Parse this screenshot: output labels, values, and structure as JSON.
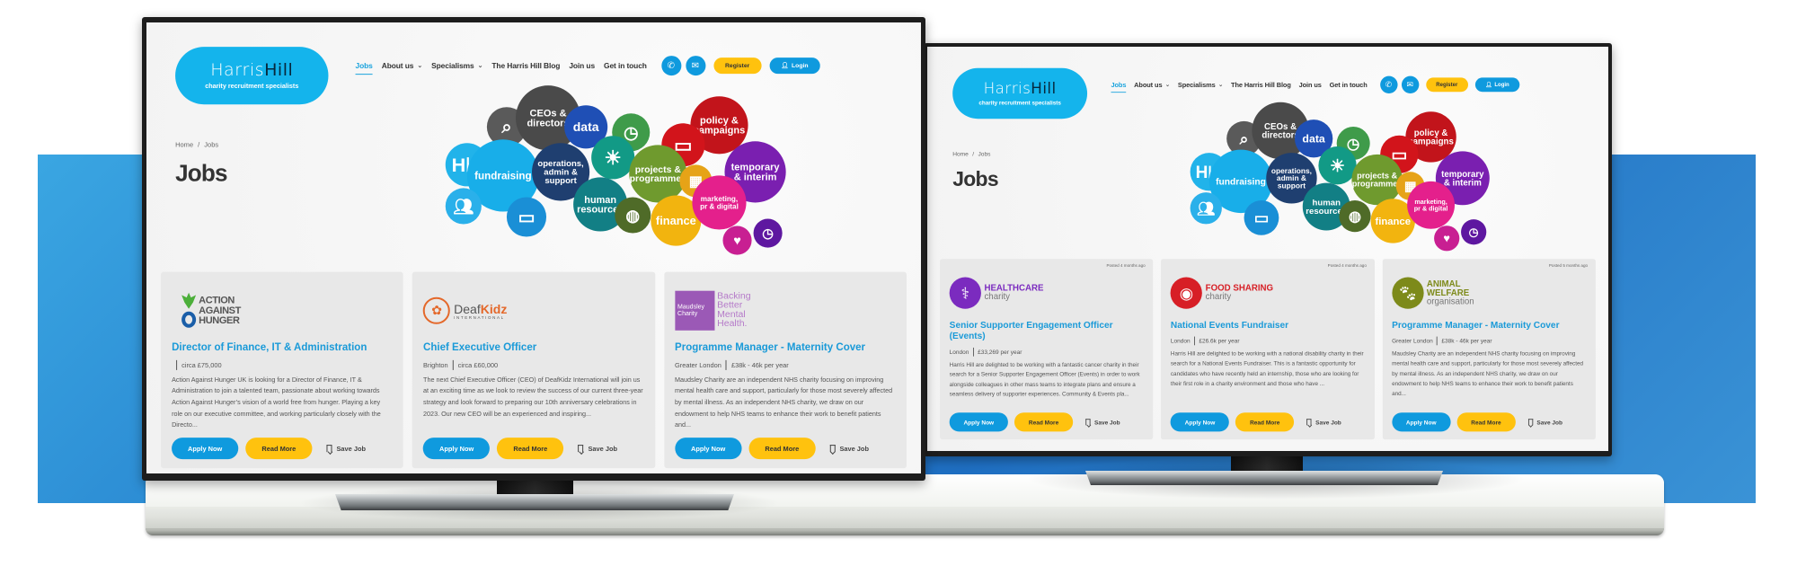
{
  "site": {
    "logo": {
      "word_light": "Harris",
      "word_bold": "Hill",
      "tagline": "charity recruitment specialists"
    },
    "nav": [
      {
        "label": "Jobs",
        "active": true,
        "dropdown": false
      },
      {
        "label": "About us",
        "active": false,
        "dropdown": true
      },
      {
        "label": "Specialisms",
        "active": false,
        "dropdown": true
      },
      {
        "label": "The Harris Hill Blog",
        "active": false,
        "dropdown": false
      },
      {
        "label": "Join us",
        "active": false,
        "dropdown": false
      },
      {
        "label": "Get in touch",
        "active": false,
        "dropdown": false
      }
    ],
    "icons": {
      "phone": "phone-icon",
      "email": "email-icon",
      "user": "user-icon",
      "chevron": "chevron-down-icon",
      "bookmark": "bookmark-icon"
    },
    "register_label": "Register",
    "login_label": "Login",
    "breadcrumb": [
      "Home",
      "Jobs"
    ],
    "breadcrumb_sep": "/",
    "page_title": "Jobs",
    "apply_label": "Apply Now",
    "read_more_label": "Read More",
    "save_label": "Save Job"
  },
  "banner_bubbles": [
    {
      "label": "",
      "icon": "search-icon",
      "color": "#5a5a5a"
    },
    {
      "label": "CEOs &\ndirectors",
      "color": "#4a4a4a"
    },
    {
      "label": "data",
      "color": "#1f4fb5"
    },
    {
      "label": "",
      "icon": "clock-icon",
      "color": "#3f9b4a"
    },
    {
      "label": "",
      "icon": "lightbulb-icon",
      "color": "#129a86"
    },
    {
      "label": "policy &\ncampaigns",
      "color": "#c2141b"
    },
    {
      "label": "",
      "icon": "laptop-icon",
      "color": "#d2141b"
    },
    {
      "label": "",
      "icon": "hh-icon",
      "color": "#21b3ea"
    },
    {
      "label": "fundraising",
      "color": "#18aee9"
    },
    {
      "label": "operations,\nadmin &\nsupport",
      "color": "#1f3f70"
    },
    {
      "label": "projects &\nprogrammes",
      "color": "#6f9a2e"
    },
    {
      "label": "",
      "icon": "calculator-icon",
      "color": "#e6a317"
    },
    {
      "label": "temporary\n& interim",
      "color": "#7a1fb0"
    },
    {
      "label": "",
      "icon": "people-icon",
      "color": "#2ab0ea"
    },
    {
      "label": "",
      "icon": "laptop-icon",
      "color": "#1a8fd6"
    },
    {
      "label": "human\nresources",
      "color": "#127f85"
    },
    {
      "label": "",
      "icon": "globe-icon",
      "color": "#4f6b28"
    },
    {
      "label": "finance",
      "color": "#f2b40f"
    },
    {
      "label": "marketing,\npr & digital",
      "color": "#e4208c"
    },
    {
      "label": "",
      "icon": "heart-icon",
      "color": "#c81f92"
    },
    {
      "label": "",
      "icon": "clock-icon",
      "color": "#5e17a0"
    }
  ],
  "monitors": [
    {
      "jobs": [
        {
          "logo": {
            "type": "aah",
            "lines": [
              "ACTION",
              "AGAINST",
              "HUNGER"
            ]
          },
          "title": "Director of Finance, IT & Administration",
          "location": "",
          "salary": "circa £75,000",
          "description": "Action Against Hunger UK is looking for a Director of Finance, IT & Administration to join a talented team, passionate about working towards Action Against Hunger’s vision of a world free from hunger. Playing a key role on our executive committee, and working particularly closely with the Directo...",
          "posted": ""
        },
        {
          "logo": {
            "type": "deafkidz",
            "word_light": "Deaf",
            "word_bold": "Kidz",
            "sub": "INTERNATIONAL"
          },
          "title": "Chief Executive Officer",
          "location": "Brighton",
          "salary": "circa £60,000",
          "description": "The next Chief Executive Officer (CEO) of DeafKidz International will join us at an exciting time as we look to review the success of our current three-year strategy and look forward to preparing our 10th anniversary celebrations in 2023. Our new CEO will be an experienced and inspiring...",
          "posted": ""
        },
        {
          "logo": {
            "type": "maudsley",
            "box": [
              "Maudsley",
              "Charity"
            ],
            "words": [
              "Backing",
              "Better",
              "Mental",
              "Health."
            ]
          },
          "title": "Programme Manager - Maternity Cover",
          "location": "Greater London",
          "salary": "£38k - 46k per year",
          "description": "Maudsley Charity are an independent NHS charity focusing on improving mental health care and support, particularly for those most severely affected by mental illness. As an independent NHS charity, we draw on our endowment to help NHS teams to enhance their work to benefit patients and...",
          "posted": ""
        }
      ]
    },
    {
      "jobs": [
        {
          "logo": {
            "type": "circle",
            "bold": "HEALTHCARE",
            "light": "charity",
            "color": "#7b2bbf",
            "icon": "stethoscope-icon"
          },
          "title": "Senior Supporter Engagement Officer (Events)",
          "location": "London",
          "salary": "£33,269 per year",
          "description": "Harris Hill are delighted to be working with a fantastic cancer charity in their search for a Senior Supporter Engagement Officer (Events) in order to work alongside colleagues in other mass teams to integrate plans and ensure a seamless delivery of supporter experiences.   Community & Events pla...",
          "posted": "Posted 4 months ago"
        },
        {
          "logo": {
            "type": "circle",
            "bold": "FOOD SHARING",
            "light": "charity",
            "color": "#d71f26",
            "icon": "plate-icon"
          },
          "title": "National Events Fundraiser",
          "location": "London",
          "salary": "£26.6k per year",
          "description": "Harris Hill are delighted to be working with a national disability charity in their search for a National Events Fundraiser. This is a fantastic opportunity for candidates who have recently held an internship, those who are looking for their first role in a charity environment and those who have ...",
          "posted": "Posted 4 months ago"
        },
        {
          "logo": {
            "type": "circle",
            "bold": "ANIMAL\nWELFARE",
            "light": "organisation",
            "color": "#7d8a1a",
            "icon": "paw-icon"
          },
          "title": "Programme Manager - Maternity Cover",
          "location": "Greater London",
          "salary": "£38k - 46k per year",
          "description": "Maudsley Charity are an independent NHS charity focusing on improving mental health care and support, particularly for those most severely affected by mental illness. As an independent NHS charity, we draw on our endowment to help NHS teams to enhance their work to benefit patients and...",
          "posted": "Posted 5 months ago"
        }
      ]
    }
  ]
}
